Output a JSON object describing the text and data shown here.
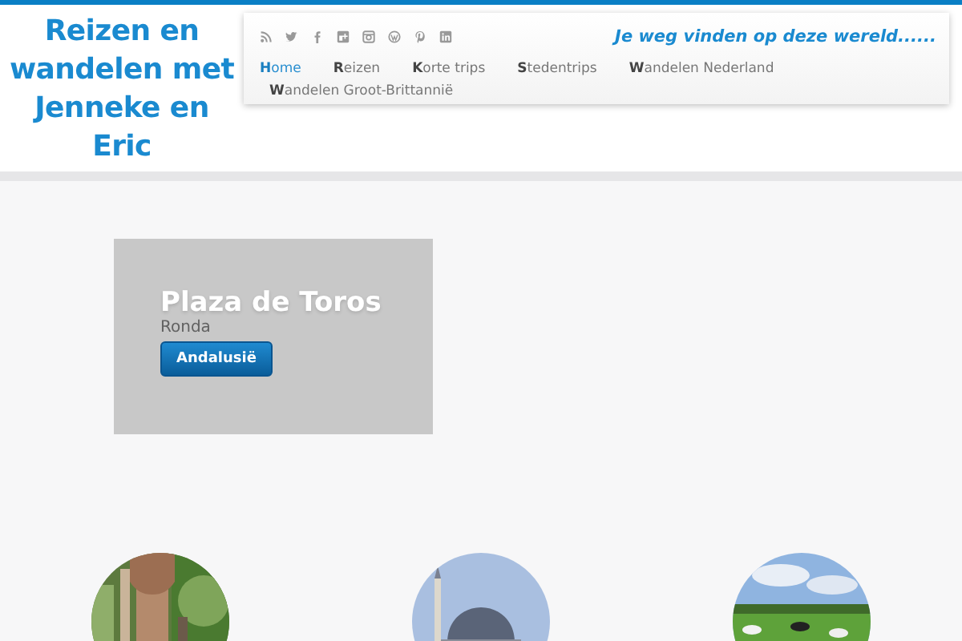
{
  "site_title": "Reizen en wandelen met Jenneke en Eric",
  "social_icons": [
    {
      "kind": "rss"
    },
    {
      "kind": "twitter"
    },
    {
      "kind": "facebook"
    },
    {
      "kind": "googleplus"
    },
    {
      "kind": "instagram"
    },
    {
      "kind": "wordpress"
    },
    {
      "kind": "pinterest"
    },
    {
      "kind": "linkedin"
    }
  ],
  "tagline": "Je weg vinden op deze wereld......",
  "nav": [
    {
      "label": "Home",
      "selected": true
    },
    {
      "label": "Reizen",
      "selected": false
    },
    {
      "label": "Korte trips",
      "selected": false
    },
    {
      "label": "Stedentrips",
      "selected": false
    },
    {
      "label": "Wandelen Nederland",
      "selected": false
    },
    {
      "label": "Wandelen Groot-Brittannië",
      "selected": false
    }
  ],
  "slide": {
    "title": "Plaza de Toros",
    "subtitle": "Ronda",
    "button": "Andalusië"
  }
}
